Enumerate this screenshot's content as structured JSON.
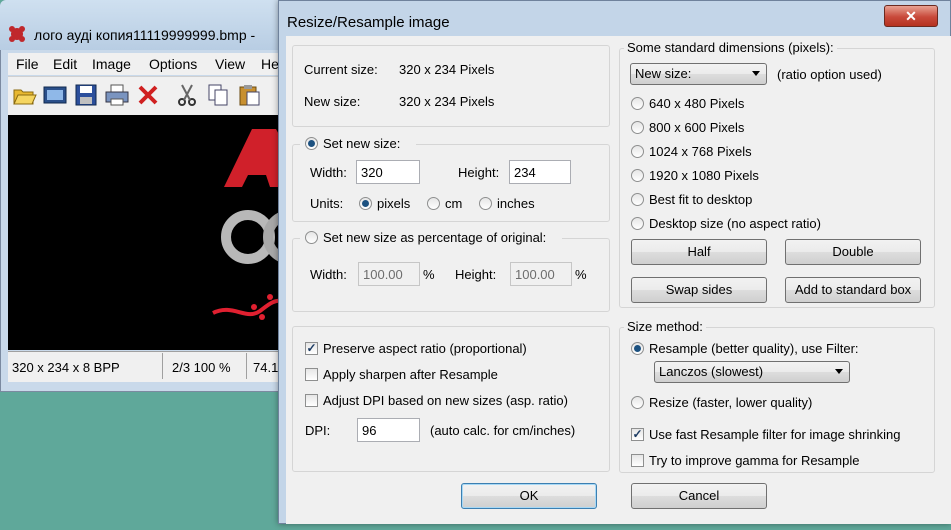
{
  "background_window": {
    "title": "лого ауді копия11119999999.bmp -",
    "menu": [
      "File",
      "Edit",
      "Image",
      "Options",
      "View",
      "He"
    ],
    "toolbar_icons": [
      "open-icon",
      "slideshow-icon",
      "save-icon",
      "print-icon",
      "delete-icon",
      "cut-icon",
      "copy-icon",
      "paste-icon"
    ],
    "status": {
      "info": "320 x 234 x 8 BPP",
      "page": "2/3 100 %",
      "extra": "74.1"
    }
  },
  "dialog": {
    "title": "Resize/Resample image",
    "close_label": "✕",
    "current_size_label": "Current size:",
    "current_size_value": "320  x  234  Pixels",
    "new_size_label": "New size:",
    "new_size_value": "320  x  234  Pixels",
    "set_new_size_label": "Set new size:",
    "width_label": "Width:",
    "width_value": "320",
    "height_label": "Height:",
    "height_value": "234",
    "units_label": "Units:",
    "units": [
      "pixels",
      "cm",
      "inches"
    ],
    "percent_label": "Set new size as percentage of original:",
    "pct_width_label": "Width:",
    "pct_width_value": "100.00",
    "pct_height_label": "Height:",
    "pct_height_value": "100.00",
    "percent_sign": "%",
    "preserve_aspect": "Preserve aspect ratio (proportional)",
    "apply_sharpen": "Apply sharpen after Resample",
    "adjust_dpi": "Adjust DPI based on new sizes (asp. ratio)",
    "dpi_label": "DPI:",
    "dpi_value": "96",
    "dpi_note": "(auto calc. for cm/inches)",
    "std_dims_legend": "Some standard dimensions (pixels):",
    "std_combo_value": "New size:",
    "ratio_note": "(ratio option used)",
    "std_options": [
      "640 x 480 Pixels",
      "800 x 600 Pixels",
      "1024 x 768 Pixels",
      "1920 x 1080 Pixels",
      "Best fit to desktop",
      "Desktop size (no aspect ratio)"
    ],
    "half_btn": "Half",
    "double_btn": "Double",
    "swap_btn": "Swap sides",
    "add_std_btn": "Add to standard box",
    "size_method_legend": "Size method:",
    "resample_label": "Resample (better quality), use Filter:",
    "filter_value": "Lanczos (slowest)",
    "resize_label": "Resize (faster, lower quality)",
    "fast_filter": "Use fast Resample filter for image shrinking",
    "gamma": "Try to improve gamma for Resample",
    "ok_btn": "OK",
    "cancel_btn": "Cancel"
  },
  "colors": {
    "desktop": "#5fa89a",
    "dialog_frame": "#c3d5e8",
    "audi_red": "#d0202a"
  }
}
